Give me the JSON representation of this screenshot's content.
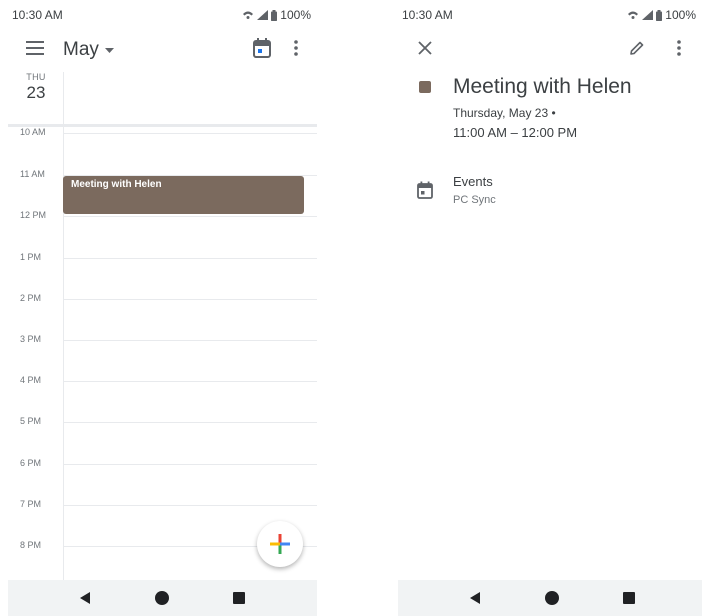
{
  "left": {
    "status": {
      "time": "10:30 AM",
      "battery": "100%"
    },
    "header": {
      "month": "May"
    },
    "day": {
      "weekday": "THU",
      "date": "23"
    },
    "hours": [
      "10 AM",
      "11 AM",
      "12 PM",
      "1 PM",
      "2 PM",
      "3 PM",
      "4 PM",
      "5 PM",
      "6 PM",
      "7 PM",
      "8 PM"
    ],
    "event": {
      "title": "Meeting with Helen",
      "color": "#7b6a5e"
    },
    "icons": [
      "menu-icon",
      "dropdown-arrow-icon",
      "today-icon",
      "more-vert-icon",
      "add-icon"
    ]
  },
  "right": {
    "status": {
      "time": "10:30 AM",
      "battery": "100%"
    },
    "event": {
      "title": "Meeting with Helen",
      "date": "Thursday, May 23  •",
      "time": "11:00 AM – 12:00 PM",
      "color": "#7b6a5e"
    },
    "calendar": {
      "name": "Events",
      "account": "PC Sync"
    },
    "icons": [
      "close-icon",
      "edit-icon",
      "more-vert-icon",
      "calendar-icon"
    ]
  },
  "navigation": [
    "back-icon",
    "home-icon",
    "recents-icon"
  ]
}
